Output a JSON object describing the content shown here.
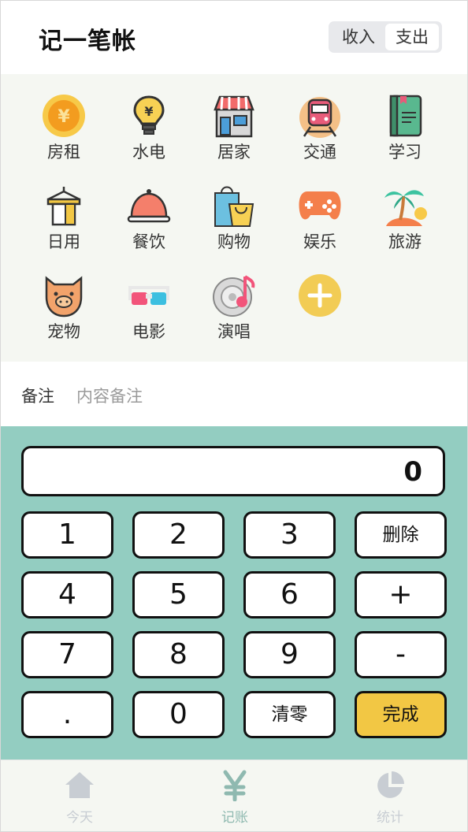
{
  "header": {
    "title": "记一笔帐",
    "toggle": {
      "income_label": "收入",
      "expense_label": "支出",
      "selected": "支出"
    }
  },
  "categories": [
    {
      "label": "房租",
      "icon": "coin-yen-icon"
    },
    {
      "label": "水电",
      "icon": "lightbulb-yen-icon"
    },
    {
      "label": "居家",
      "icon": "house-shop-icon"
    },
    {
      "label": "交通",
      "icon": "train-icon"
    },
    {
      "label": "学习",
      "icon": "book-icon"
    },
    {
      "label": "日用",
      "icon": "towel-rack-icon"
    },
    {
      "label": "餐饮",
      "icon": "dish-cloche-icon"
    },
    {
      "label": "购物",
      "icon": "shopping-bags-icon"
    },
    {
      "label": "娱乐",
      "icon": "gamepad-icon"
    },
    {
      "label": "旅游",
      "icon": "palm-island-icon"
    },
    {
      "label": "宠物",
      "icon": "pet-dog-icon"
    },
    {
      "label": "电影",
      "icon": "3d-glasses-icon"
    },
    {
      "label": "演唱",
      "icon": "music-disc-icon"
    }
  ],
  "add_category": {
    "icon": "plus-circle-icon"
  },
  "note": {
    "label": "备注",
    "placeholder": "内容备注"
  },
  "keypad": {
    "display": "0",
    "keys": [
      "1",
      "2",
      "3",
      "删除",
      "4",
      "5",
      "6",
      "+",
      "7",
      "8",
      "9",
      "-",
      ".",
      "0",
      "清零",
      "完成"
    ]
  },
  "tabbar": {
    "tabs": [
      {
        "label": "今天",
        "icon": "home-icon",
        "active": false
      },
      {
        "label": "记账",
        "icon": "yen-icon",
        "active": true
      },
      {
        "label": "统计",
        "icon": "pie-chart-icon",
        "active": false
      }
    ]
  },
  "colors": {
    "keypad_bg": "#93cdc1",
    "done_key": "#f2c744",
    "category_bg": "#f5f7f2",
    "active_tab": "#8fb9b0",
    "inactive_tab": "#c8cdd3"
  }
}
